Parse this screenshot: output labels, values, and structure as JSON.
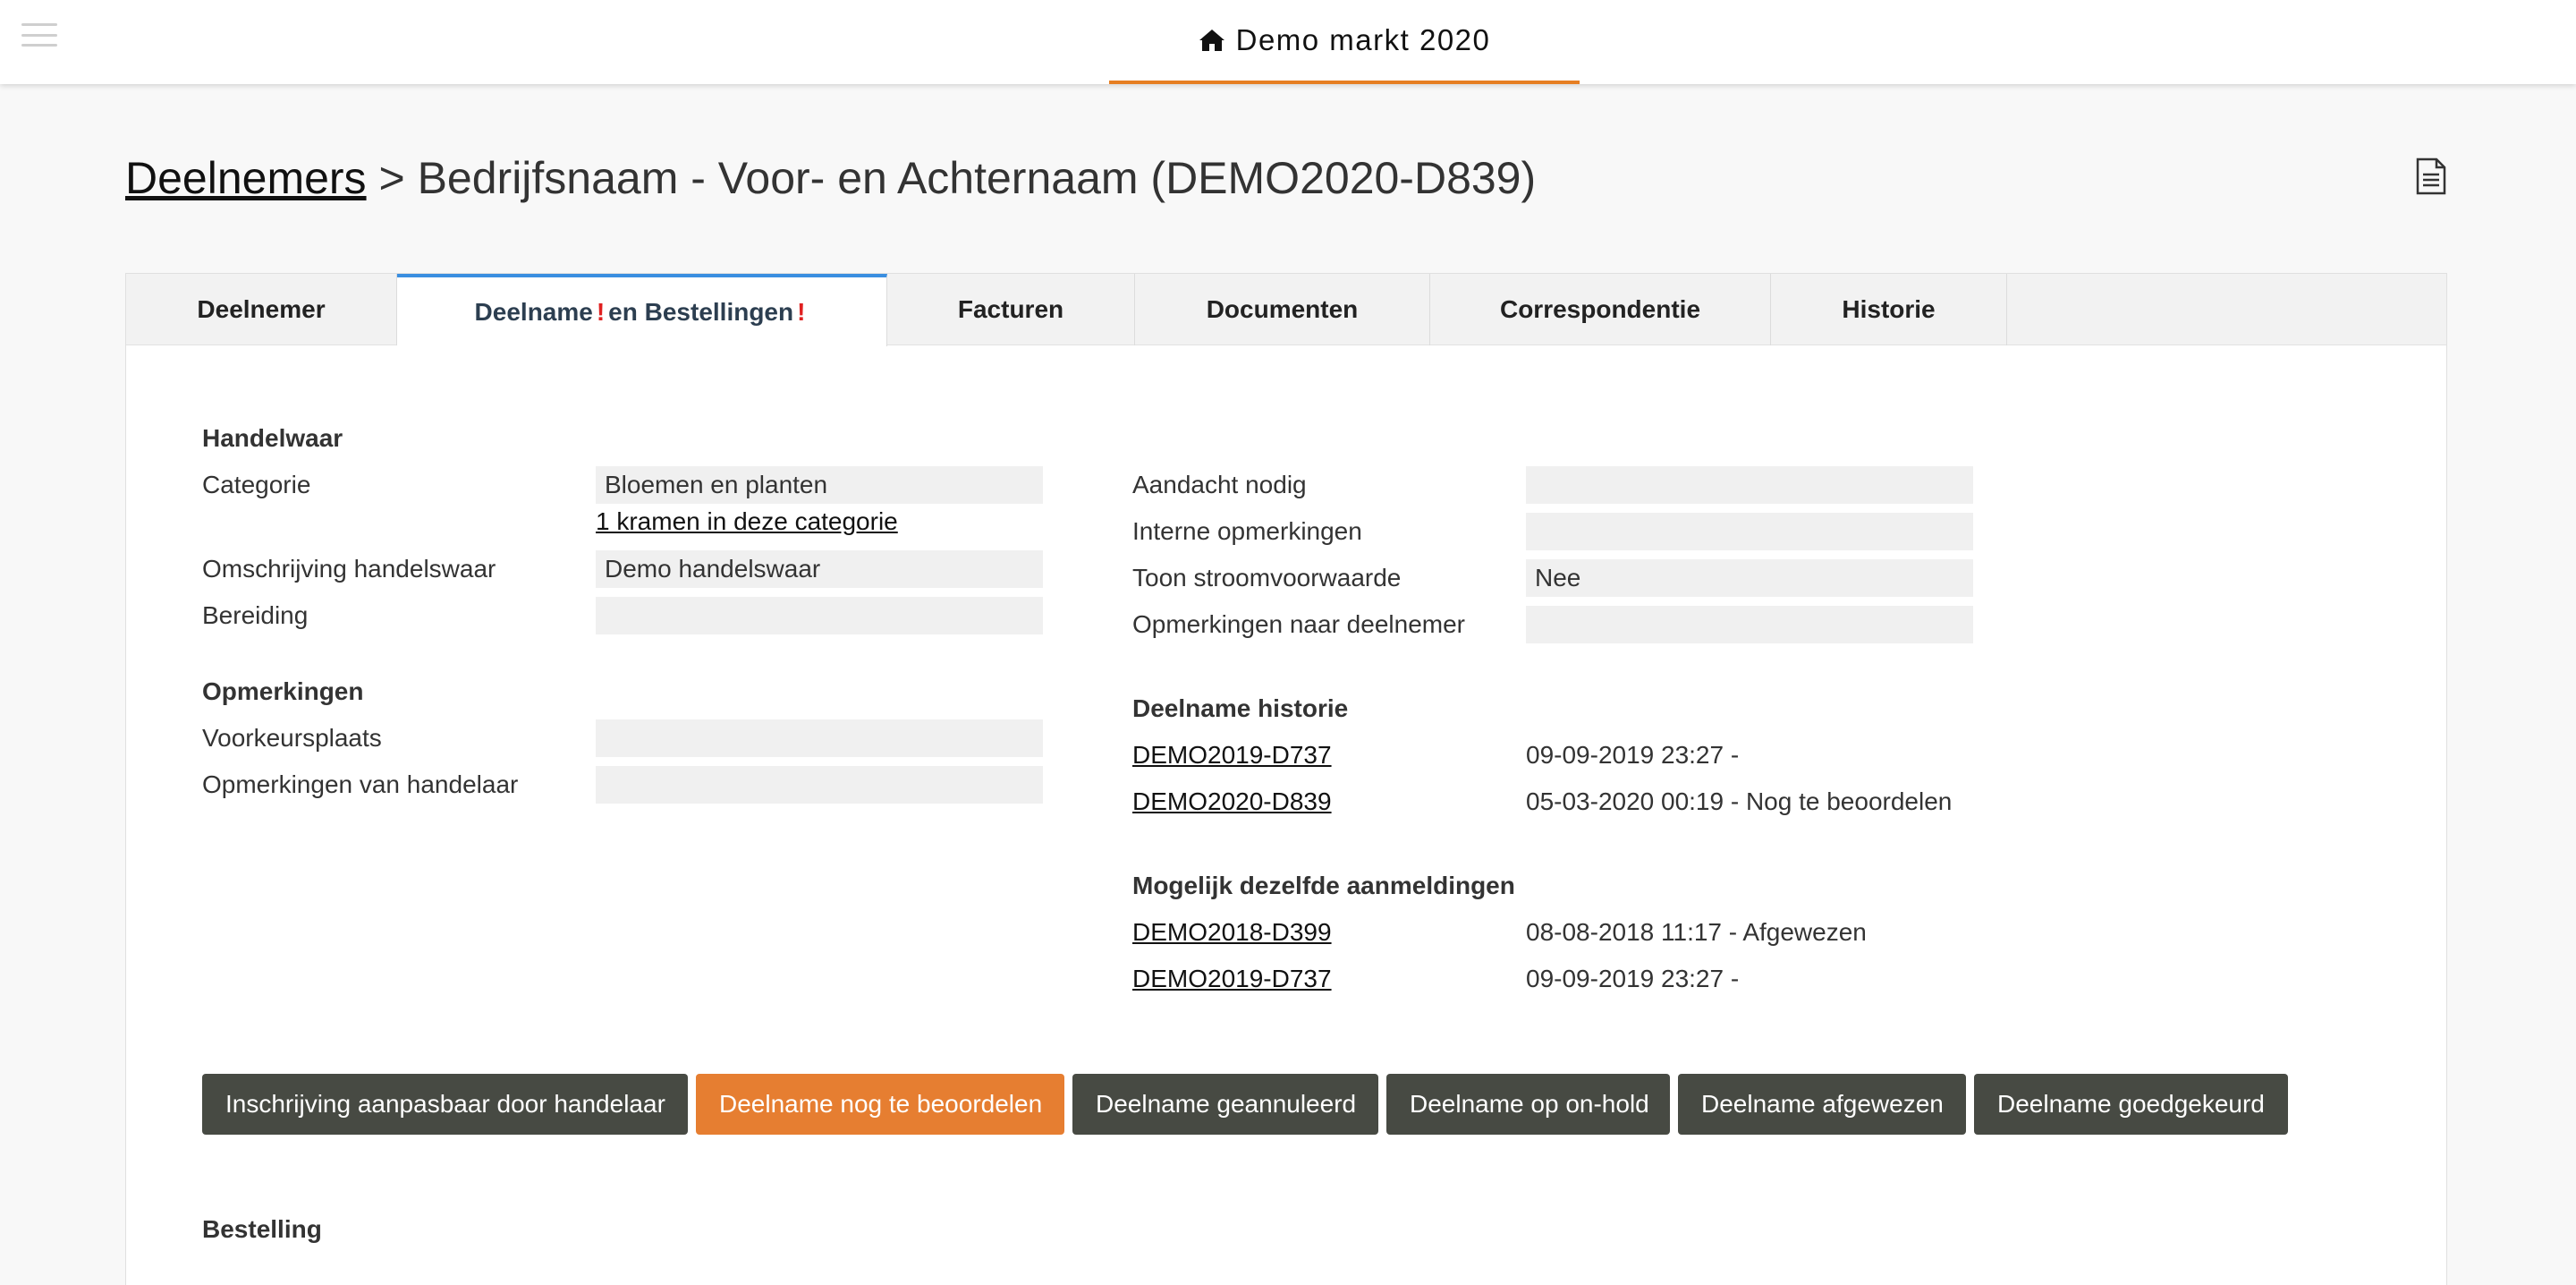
{
  "header": {
    "market_title": "Demo markt 2020",
    "accent_color": "#e67e22",
    "icons": {
      "menu": "hamburger-icon",
      "home": "home-icon",
      "document": "document-icon"
    }
  },
  "breadcrumb": {
    "root": "Deelnemers",
    "separator": ">",
    "current": "Bedrijfsnaam - Voor- en Achternaam (DEMO2020-D839)"
  },
  "tabs": [
    {
      "label": "Deelnemer"
    },
    {
      "label_part1": "Deelname",
      "label_part2": "en Bestellingen",
      "alert": "!"
    },
    {
      "label": "Facturen"
    },
    {
      "label": "Documenten"
    },
    {
      "label": "Correspondentie"
    },
    {
      "label": "Historie"
    }
  ],
  "handelwaar": {
    "section_title": "Handelwaar",
    "categorie_label": "Categorie",
    "categorie_value": "Bloemen en planten",
    "kramen_link": "1 kramen in deze categorie",
    "omschrijving_label": "Omschrijving handelswaar",
    "omschrijving_value": "Demo handelswaar",
    "bereiding_label": "Bereiding",
    "bereiding_value": ""
  },
  "opmerkingen": {
    "section_title": "Opmerkingen",
    "voorkeursplaats_label": "Voorkeursplaats",
    "voorkeursplaats_value": "",
    "handelaar_label": "Opmerkingen van handelaar",
    "handelaar_value": ""
  },
  "status_fields": {
    "aandacht_label": "Aandacht nodig",
    "aandacht_value": "",
    "interne_label": "Interne opmerkingen",
    "interne_value": "",
    "stroom_label": "Toon stroomvoorwaarde",
    "stroom_value": "Nee",
    "naar_deelnemer_label": "Opmerkingen naar deelnemer",
    "naar_deelnemer_value": ""
  },
  "historie": {
    "section_title": "Deelname historie",
    "items": [
      {
        "code": "DEMO2019-D737",
        "info": "09-09-2019 23:27 -"
      },
      {
        "code": "DEMO2020-D839",
        "info": "05-03-2020 00:19 - Nog te beoordelen"
      }
    ]
  },
  "dezelfde": {
    "section_title": "Mogelijk dezelfde aanmeldingen",
    "items": [
      {
        "code": "DEMO2018-D399",
        "info": "08-08-2018 11:17 - Afgewezen"
      },
      {
        "code": "DEMO2019-D737",
        "info": "09-09-2019 23:27 -"
      }
    ]
  },
  "actions": {
    "aanpasbaar": "Inschrijving aanpasbaar door handelaar",
    "nog_te_beoordelen": "Deelname nog te beoordelen",
    "geannuleerd": "Deelname geannuleerd",
    "on_hold": "Deelname op on-hold",
    "afgewezen": "Deelname afgewezen",
    "goedgekeurd": "Deelname goedgekeurd",
    "active_color": "#e67e31",
    "default_color": "#474a43"
  },
  "bestelling": {
    "section_title": "Bestelling"
  }
}
